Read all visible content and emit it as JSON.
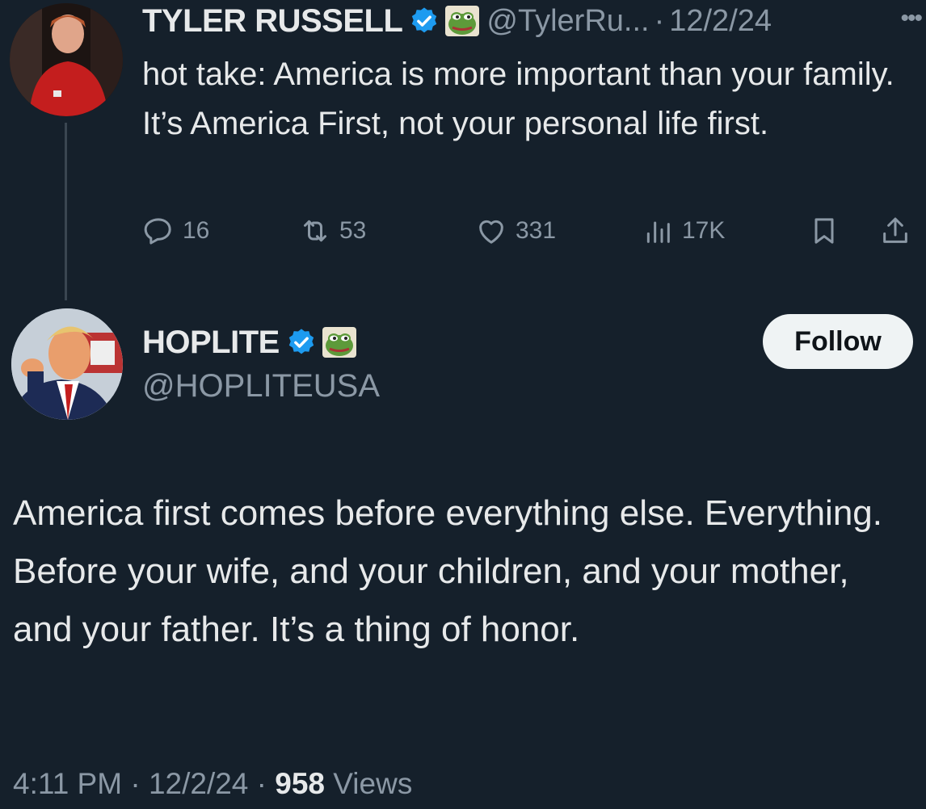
{
  "parent_tweet": {
    "author_name": "TYLER RUSSELL",
    "handle": "@TylerRu...",
    "separator": "·",
    "date": "12/2/24",
    "text": "hot take: America is more important than your family. It’s America First, not your personal life first.",
    "actions": {
      "replies": "16",
      "reposts": "53",
      "likes": "331",
      "views": "17K"
    },
    "icons": [
      "verified-badge-icon",
      "pepe-emoji-icon",
      "more-icon",
      "reply-icon",
      "repost-icon",
      "like-icon",
      "views-icon",
      "bookmark-icon",
      "share-icon"
    ]
  },
  "reply_tweet": {
    "author_name": "HOPLITE",
    "handle": "@HOPLITEUSA",
    "follow_label": "Follow",
    "text": "America first comes before everything else. Everything. Before your wife, and your children, and your mother, and your father. It’s a thing of honor.",
    "time": "4:11 PM",
    "date": "12/2/24",
    "separator": "·",
    "views_count": "958",
    "views_label": "Views"
  },
  "colors": {
    "background": "#15202b",
    "text_primary": "#e7e9ea",
    "text_secondary": "#8b98a5",
    "verified_blue": "#1d9bf0",
    "follow_button_bg": "#eff3f4"
  }
}
